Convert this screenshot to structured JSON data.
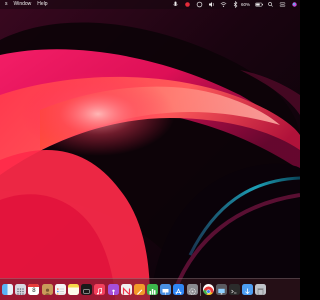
{
  "menubar": {
    "items": [
      "s",
      "Window",
      "Help"
    ],
    "battery_percent": "60%",
    "status_icons": [
      "mic-icon",
      "wifi-icon",
      "bluetooth-icon",
      "volume-icon",
      "battery-icon",
      "control-center-icon",
      "search-icon",
      "user-icon",
      "siri-icon",
      "creative-cloud-icon",
      "notification-icon"
    ]
  },
  "calendar": {
    "day": "8"
  },
  "dock": {
    "apps": [
      {
        "name": "finder-icon",
        "color": "#3a9bf0"
      },
      {
        "name": "launchpad-icon",
        "color": "#d8d8e0"
      },
      {
        "name": "calendar-icon",
        "color": "#ffffff"
      },
      {
        "name": "contacts-icon",
        "color": "#c99a5a"
      },
      {
        "name": "reminders-icon",
        "color": "#f4f4f4"
      },
      {
        "name": "notes-icon",
        "color": "#f7d84a"
      },
      {
        "name": "tv-icon",
        "color": "#1a1a1a"
      },
      {
        "name": "music-icon",
        "color": "#f2405c"
      },
      {
        "name": "podcasts-icon",
        "color": "#a64fd8"
      },
      {
        "name": "news-icon",
        "color": "#f0f0f0"
      },
      {
        "name": "pages-icon",
        "color": "#f39a2a"
      },
      {
        "name": "numbers-icon",
        "color": "#3cb64b"
      },
      {
        "name": "keynote-icon",
        "color": "#4a90e2"
      },
      {
        "name": "app-store-icon",
        "color": "#2f86f4"
      },
      {
        "name": "system-preferences-icon",
        "color": "#8a8a8f"
      },
      {
        "name": "chrome-icon",
        "color": "#ffffff"
      },
      {
        "name": "monitor-icon",
        "color": "#5a5a60"
      },
      {
        "name": "terminal-icon",
        "color": "#2b2b2b"
      },
      {
        "name": "downloads-icon",
        "color": "#4d9ef2"
      },
      {
        "name": "trash-icon",
        "color": "#bfc3c9"
      }
    ]
  }
}
